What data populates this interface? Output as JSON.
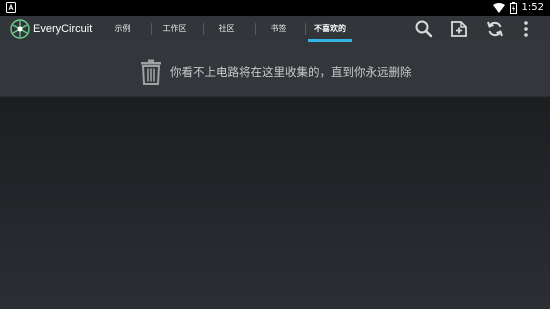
{
  "status_bar": {
    "time": "1:52",
    "icons": [
      "notification-a-icon",
      "wifi-icon",
      "battery-icon"
    ]
  },
  "app_bar": {
    "title": "EveryCircuit",
    "logo_icon": "everycircuit-logo-icon",
    "tabs": [
      {
        "label": "示例",
        "active": false
      },
      {
        "label": "工作区",
        "active": false
      },
      {
        "label": "社区",
        "active": false
      },
      {
        "label": "书签",
        "active": false
      },
      {
        "label": "不喜欢的",
        "active": true
      }
    ],
    "actions": [
      "search-icon",
      "add-circuit-icon",
      "sync-icon",
      "overflow-menu-icon"
    ],
    "accent_color": "#33b5e5"
  },
  "banner": {
    "icon": "trash-icon",
    "text": "你看不上电路将在这里收集的，直到你永远删除"
  }
}
